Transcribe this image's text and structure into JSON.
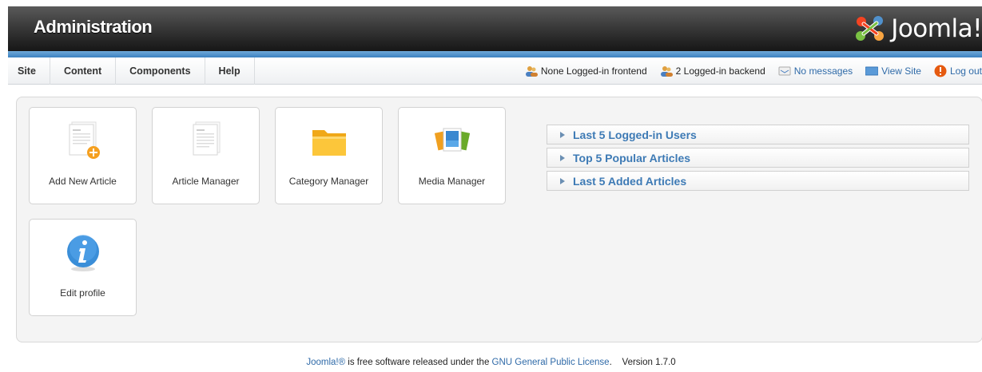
{
  "header": {
    "title": "Administration",
    "logo_text": "Joomla!"
  },
  "menu": [
    {
      "label": "Site"
    },
    {
      "label": "Content"
    },
    {
      "label": "Components"
    },
    {
      "label": "Help"
    }
  ],
  "status": {
    "frontend": "None Logged-in frontend",
    "backend": "2 Logged-in backend",
    "messages": "No messages",
    "view_site": "View Site",
    "logout": "Log out"
  },
  "tiles": [
    {
      "label": "Add New Article"
    },
    {
      "label": "Article Manager"
    },
    {
      "label": "Category Manager"
    },
    {
      "label": "Media Manager"
    },
    {
      "label": "Edit profile"
    }
  ],
  "panels": [
    {
      "label": "Last 5 Logged-in Users"
    },
    {
      "label": "Top 5 Popular Articles"
    },
    {
      "label": "Last 5 Added Articles"
    }
  ],
  "footer": {
    "joomla_link": "Joomla!®",
    "text_middle": " is free software released under the ",
    "license_link": "GNU General Public License",
    "version_text": ".    Version 1.7.0"
  },
  "colors": {
    "accent_blue": "#3c82c0",
    "link": "#2f6aa8"
  }
}
